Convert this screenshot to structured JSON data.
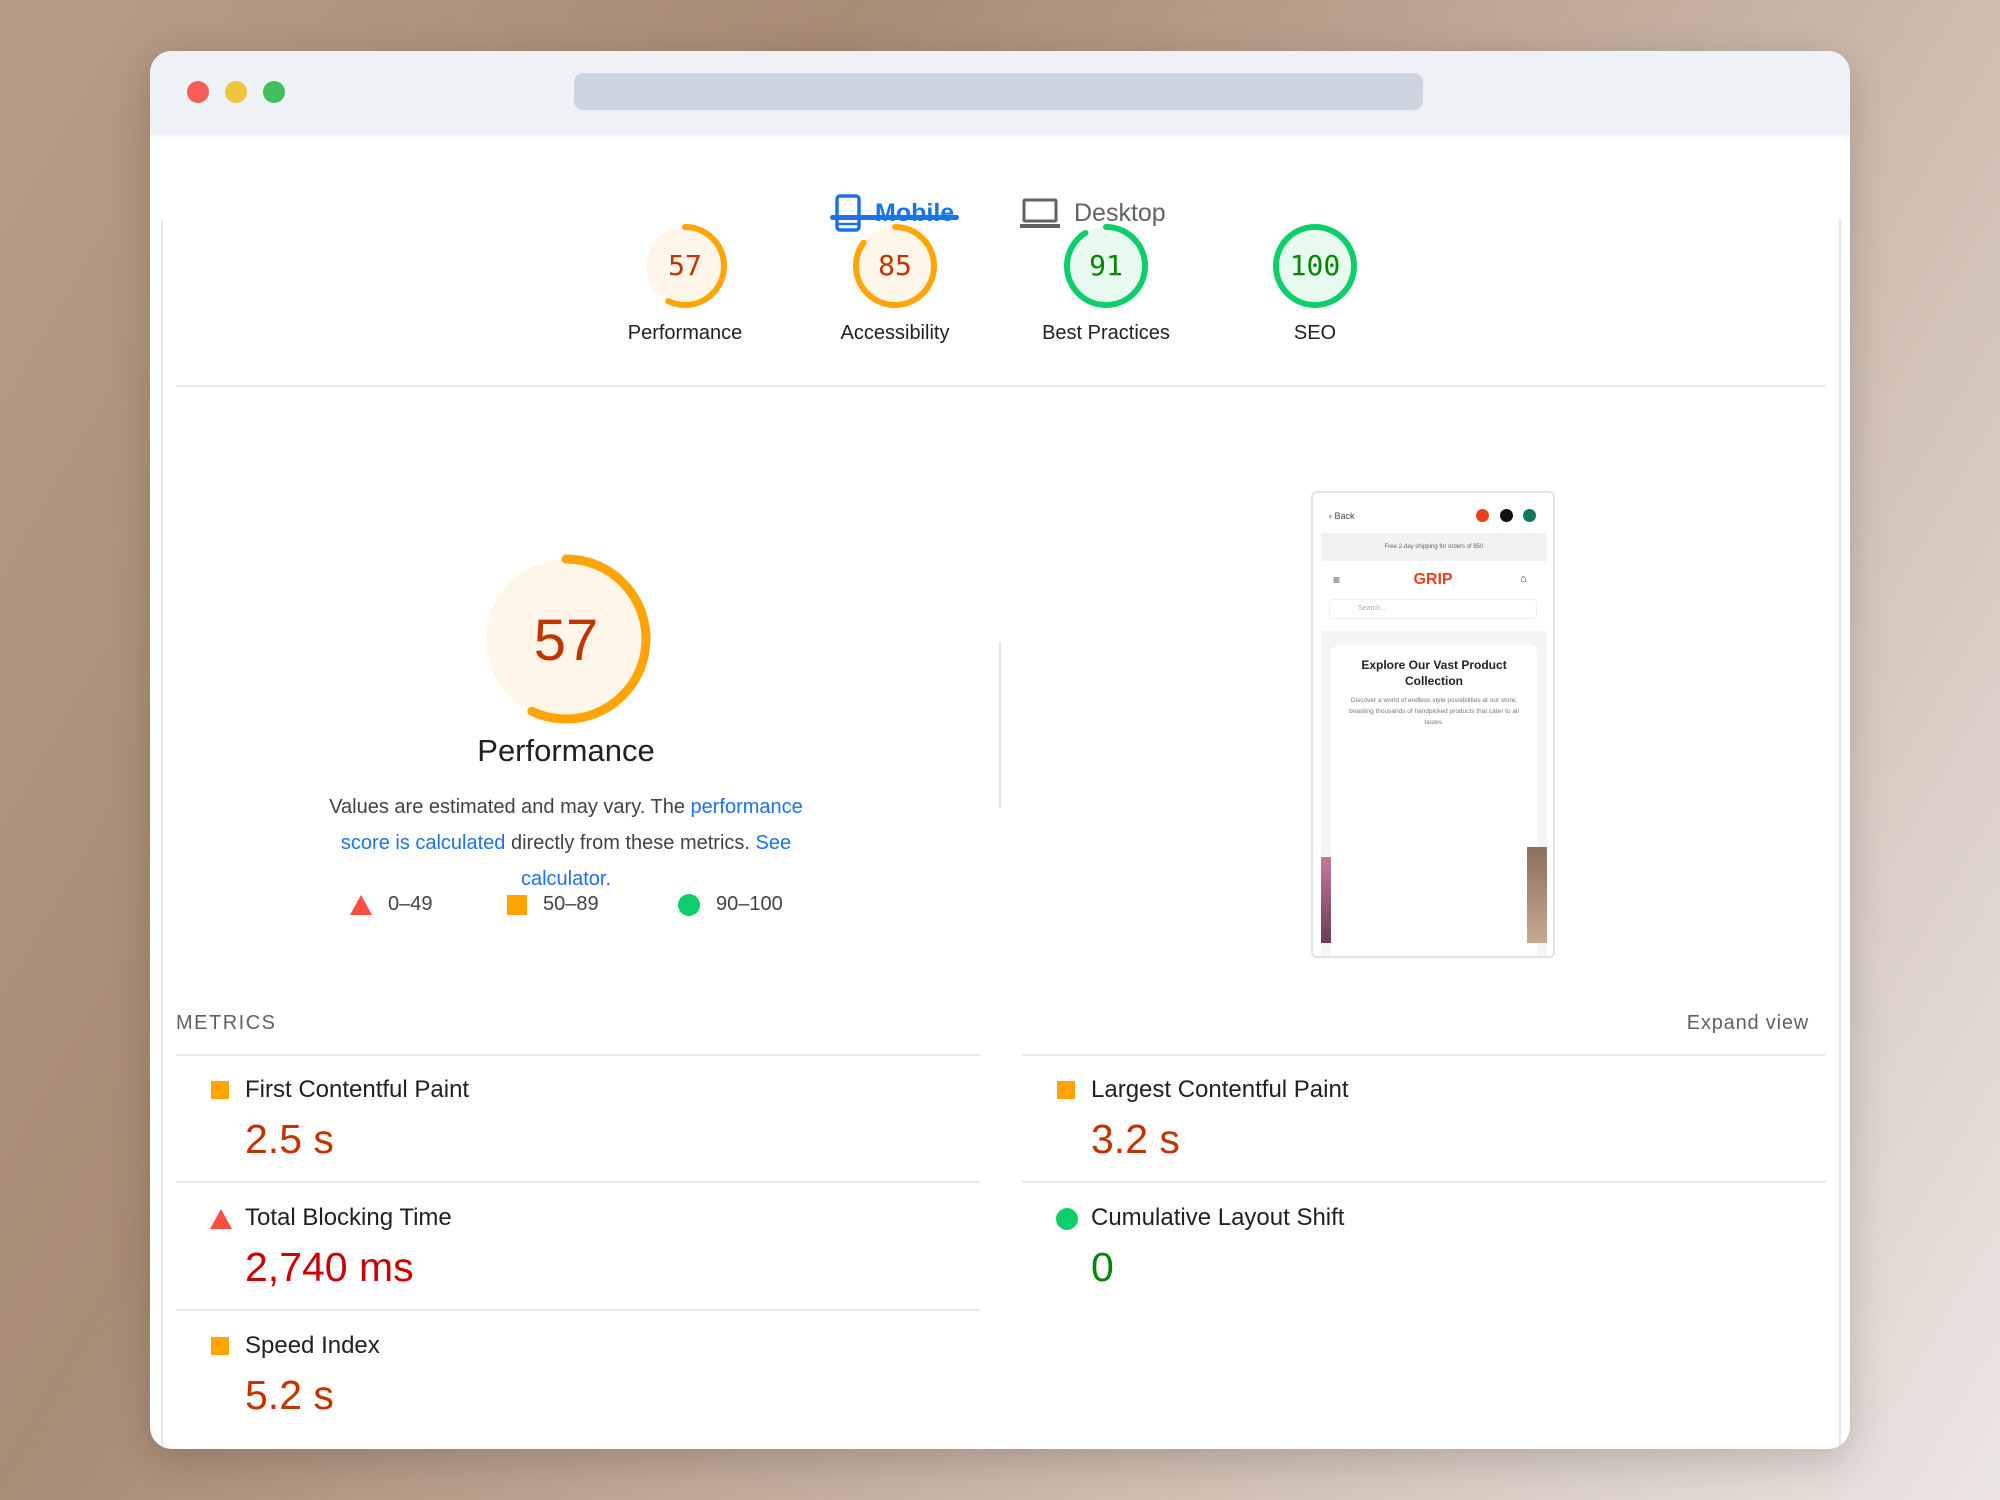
{
  "tabs": [
    {
      "label": "Mobile",
      "icon": "mobile-phone-icon",
      "active": true
    },
    {
      "label": "Desktop",
      "icon": "laptop-icon",
      "active": false
    }
  ],
  "categories": [
    {
      "label": "Performance",
      "score": 57,
      "rating": "average"
    },
    {
      "label": "Accessibility",
      "score": 85,
      "rating": "average"
    },
    {
      "label": "Best Practices",
      "score": 91,
      "rating": "pass"
    },
    {
      "label": "SEO",
      "score": 100,
      "rating": "pass"
    }
  ],
  "colors": {
    "average": "#ffa400",
    "average_text": "#c33300",
    "average_bg": "#fff6ea",
    "pass": "#0cce6b",
    "pass_text": "#008800",
    "pass_bg": "#e8f9ef",
    "fail": "#ff4e42",
    "fail_text": "#cc0000",
    "link": "#1a73e8"
  },
  "performance": {
    "score": 57,
    "title": "Performance",
    "desc_before": "Values are estimated and may vary. The ",
    "desc_link1": "performance score is calculated",
    "desc_middle": " directly from these metrics. ",
    "desc_link2": "See calculator."
  },
  "legend": [
    {
      "shape": "triangle",
      "range": "0–49"
    },
    {
      "shape": "square",
      "range": "50–89"
    },
    {
      "shape": "circle",
      "range": "90–100"
    }
  ],
  "screenshot": {
    "back": "Back",
    "banner": "Free 2-day shipping for orders of $50",
    "logo": "GRIP",
    "search_placeholder": "Search...",
    "heading": "Explore Our Vast Product Collection",
    "body": "Discover a world of endless style possibilities at our store, boasting thousands of handpicked products that cater to all tastes."
  },
  "metrics": {
    "title": "METRICS",
    "expand": "Expand view",
    "items": [
      {
        "label": "First Contentful Paint",
        "value": "2.5 s",
        "rating": "average"
      },
      {
        "label": "Largest Contentful Paint",
        "value": "3.2 s",
        "rating": "average"
      },
      {
        "label": "Total Blocking Time",
        "value": "2,740 ms",
        "rating": "fail"
      },
      {
        "label": "Cumulative Layout Shift",
        "value": "0",
        "rating": "pass"
      },
      {
        "label": "Speed Index",
        "value": "5.2 s",
        "rating": "average"
      }
    ]
  }
}
